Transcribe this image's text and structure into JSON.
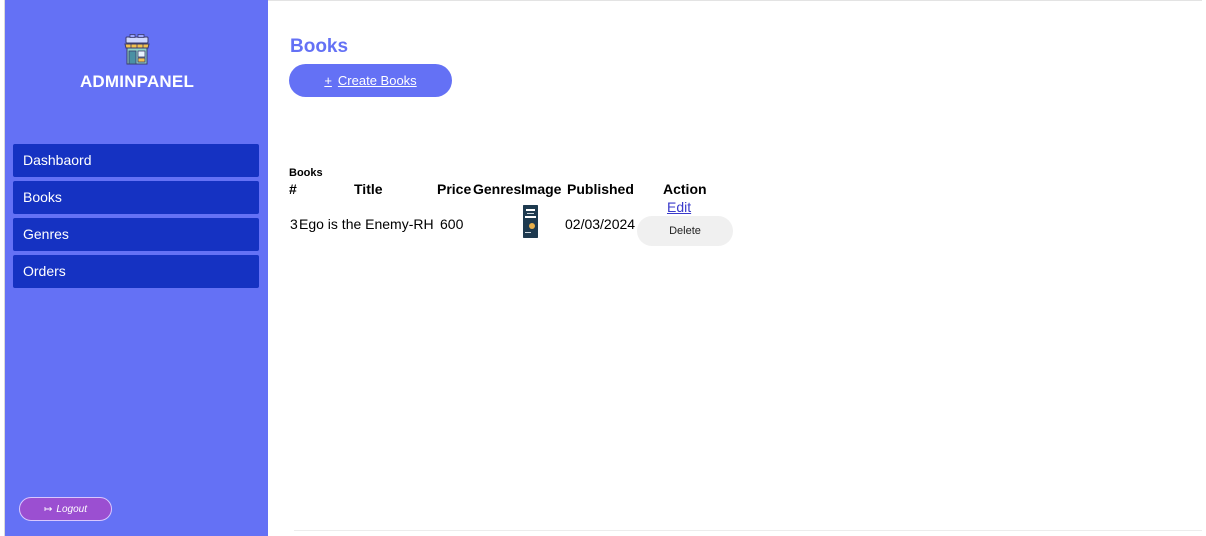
{
  "sidebar": {
    "brand_icon": "store-icon",
    "brand_title": "ADMINPANEL",
    "items": [
      {
        "label": "Dashbaord"
      },
      {
        "label": "Books"
      },
      {
        "label": "Genres"
      },
      {
        "label": "Orders"
      }
    ],
    "logout": {
      "icon": "logout-icon",
      "label": "Logout"
    }
  },
  "main": {
    "title": "Books",
    "create_button": {
      "icon": "+",
      "label": "Create Books"
    },
    "table": {
      "caption": "Books",
      "headers": {
        "id": "#",
        "title": "Title",
        "price": "Price",
        "genres": "Genres",
        "image": "Image",
        "published": "Published",
        "action": "Action"
      },
      "rows": [
        {
          "id": "3",
          "title": "Ego is the Enemy-RH",
          "price": "600",
          "genres": "",
          "image_alt": "EGO IS THE ENEMY",
          "published": "02/03/2024",
          "edit_label": "Edit",
          "delete_label": "Delete"
        }
      ]
    }
  },
  "colors": {
    "sidebar_bg": "#6471f5",
    "nav_item_bg": "#1532c2",
    "accent": "#6471f5",
    "logout_bg": "#9b4fd1",
    "link": "#3a3acb"
  }
}
